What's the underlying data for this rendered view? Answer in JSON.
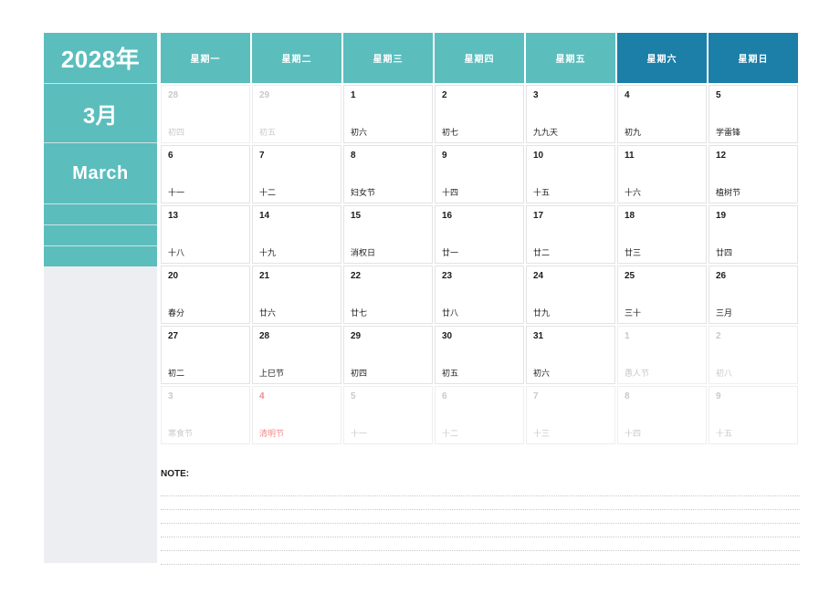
{
  "sidebar": {
    "year_label": "2028年",
    "month_cn_label": "3月",
    "month_en_label": "March"
  },
  "weekday_headers": [
    {
      "label": "星期一",
      "weekend": false
    },
    {
      "label": "星期二",
      "weekend": false
    },
    {
      "label": "星期三",
      "weekend": false
    },
    {
      "label": "星期四",
      "weekend": false
    },
    {
      "label": "星期五",
      "weekend": false
    },
    {
      "label": "星期六",
      "weekend": true
    },
    {
      "label": "星期日",
      "weekend": true
    }
  ],
  "weeks": [
    [
      {
        "day": "28",
        "lunar": "初四",
        "muted": true,
        "holiday": false
      },
      {
        "day": "29",
        "lunar": "初五",
        "muted": true,
        "holiday": false
      },
      {
        "day": "1",
        "lunar": "初六",
        "muted": false,
        "holiday": false
      },
      {
        "day": "2",
        "lunar": "初七",
        "muted": false,
        "holiday": false
      },
      {
        "day": "3",
        "lunar": "九九天",
        "muted": false,
        "holiday": false
      },
      {
        "day": "4",
        "lunar": "初九",
        "muted": false,
        "holiday": false
      },
      {
        "day": "5",
        "lunar": "学雷锋",
        "muted": false,
        "holiday": false
      }
    ],
    [
      {
        "day": "6",
        "lunar": "十一",
        "muted": false,
        "holiday": false
      },
      {
        "day": "7",
        "lunar": "十二",
        "muted": false,
        "holiday": false
      },
      {
        "day": "8",
        "lunar": "妇女节",
        "muted": false,
        "holiday": false
      },
      {
        "day": "9",
        "lunar": "十四",
        "muted": false,
        "holiday": false
      },
      {
        "day": "10",
        "lunar": "十五",
        "muted": false,
        "holiday": false
      },
      {
        "day": "11",
        "lunar": "十六",
        "muted": false,
        "holiday": false
      },
      {
        "day": "12",
        "lunar": "植树节",
        "muted": false,
        "holiday": false
      }
    ],
    [
      {
        "day": "13",
        "lunar": "十八",
        "muted": false,
        "holiday": false
      },
      {
        "day": "14",
        "lunar": "十九",
        "muted": false,
        "holiday": false
      },
      {
        "day": "15",
        "lunar": "消权日",
        "muted": false,
        "holiday": false
      },
      {
        "day": "16",
        "lunar": "廿一",
        "muted": false,
        "holiday": false
      },
      {
        "day": "17",
        "lunar": "廿二",
        "muted": false,
        "holiday": false
      },
      {
        "day": "18",
        "lunar": "廿三",
        "muted": false,
        "holiday": false
      },
      {
        "day": "19",
        "lunar": "廿四",
        "muted": false,
        "holiday": false
      }
    ],
    [
      {
        "day": "20",
        "lunar": "春分",
        "muted": false,
        "holiday": false
      },
      {
        "day": "21",
        "lunar": "廿六",
        "muted": false,
        "holiday": false
      },
      {
        "day": "22",
        "lunar": "廿七",
        "muted": false,
        "holiday": false
      },
      {
        "day": "23",
        "lunar": "廿八",
        "muted": false,
        "holiday": false
      },
      {
        "day": "24",
        "lunar": "廿九",
        "muted": false,
        "holiday": false
      },
      {
        "day": "25",
        "lunar": "三十",
        "muted": false,
        "holiday": false
      },
      {
        "day": "26",
        "lunar": "三月",
        "muted": false,
        "holiday": false
      }
    ],
    [
      {
        "day": "27",
        "lunar": "初二",
        "muted": false,
        "holiday": false
      },
      {
        "day": "28",
        "lunar": "上巳节",
        "muted": false,
        "holiday": false
      },
      {
        "day": "29",
        "lunar": "初四",
        "muted": false,
        "holiday": false
      },
      {
        "day": "30",
        "lunar": "初五",
        "muted": false,
        "holiday": false
      },
      {
        "day": "31",
        "lunar": "初六",
        "muted": false,
        "holiday": false
      },
      {
        "day": "1",
        "lunar": "愚人节",
        "muted": true,
        "holiday": false
      },
      {
        "day": "2",
        "lunar": "初八",
        "muted": true,
        "holiday": false
      }
    ],
    [
      {
        "day": "3",
        "lunar": "寒食节",
        "muted": true,
        "holiday": false
      },
      {
        "day": "4",
        "lunar": "清明节",
        "muted": true,
        "holiday": true
      },
      {
        "day": "5",
        "lunar": "十一",
        "muted": true,
        "holiday": false
      },
      {
        "day": "6",
        "lunar": "十二",
        "muted": true,
        "holiday": false
      },
      {
        "day": "7",
        "lunar": "十三",
        "muted": true,
        "holiday": false
      },
      {
        "day": "8",
        "lunar": "十四",
        "muted": true,
        "holiday": false
      },
      {
        "day": "9",
        "lunar": "十五",
        "muted": true,
        "holiday": false
      }
    ]
  ],
  "note": {
    "label": "NOTE:",
    "line_count": 6
  },
  "colors": {
    "teal": "#5cbdbd",
    "weekend_blue": "#1b7fa8",
    "sidebar_grey": "#edeef1",
    "holiday_red": "#f08a8a"
  }
}
